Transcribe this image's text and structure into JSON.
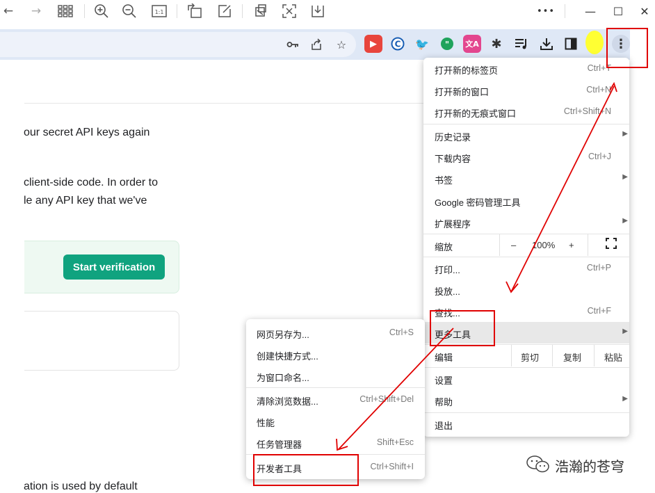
{
  "viewer_toolbar": {
    "icons": [
      "back-arrow-icon",
      "forward-arrow-icon",
      "grid-icon",
      "zoom-in-icon",
      "zoom-out-icon",
      "actual-size-icon",
      "rotate-icon",
      "edit-icon",
      "crop-icon",
      "fit-icon",
      "save-icon"
    ],
    "more": "•••",
    "minimize": "—",
    "maximize": "☐",
    "close": "✕"
  },
  "page": {
    "line1": "our secret API keys again",
    "line2": "client-side code. In order to",
    "line3": "le any API key that we've",
    "verify_button": "Start verification",
    "line4": "ation is used by default"
  },
  "main_menu": {
    "items": [
      {
        "label": "打开新的标签页",
        "shortcut": "Ctrl+T"
      },
      {
        "label": "打开新的窗口",
        "shortcut": "Ctrl+N"
      },
      {
        "label": "打开新的无痕式窗口",
        "shortcut": "Ctrl+Shift+N"
      },
      {
        "label": "历史记录",
        "arrow": "▶"
      },
      {
        "label": "下载内容",
        "shortcut": "Ctrl+J"
      },
      {
        "label": "书签",
        "arrow": "▶"
      },
      {
        "label": "Google 密码管理工具"
      },
      {
        "label": "扩展程序",
        "arrow": "▶"
      }
    ],
    "zoom": {
      "label": "缩放",
      "minus": "–",
      "value": "100%",
      "plus": "+"
    },
    "items2": [
      {
        "label": "打印...",
        "shortcut": "Ctrl+P"
      },
      {
        "label": "投放..."
      },
      {
        "label": "查找...",
        "shortcut": "Ctrl+F"
      },
      {
        "label": "更多工具",
        "arrow": "▶"
      }
    ],
    "edit": {
      "label": "编辑",
      "cut": "剪切",
      "copy": "复制",
      "paste": "粘贴"
    },
    "items3": [
      {
        "label": "设置"
      },
      {
        "label": "帮助",
        "arrow": "▶"
      },
      {
        "label": "退出"
      }
    ]
  },
  "sub_menu": {
    "items": [
      {
        "label": "网页另存为...",
        "shortcut": "Ctrl+S"
      },
      {
        "label": "创建快捷方式..."
      },
      {
        "label": "为窗口命名..."
      },
      {
        "label": "清除浏览数据...",
        "shortcut": "Ctrl+Shift+Del"
      },
      {
        "label": "性能"
      },
      {
        "label": "任务管理器",
        "shortcut": "Shift+Esc"
      },
      {
        "label": "开发者工具",
        "shortcut": "Ctrl+Shift+I"
      }
    ]
  },
  "watermark": "浩瀚的苍穹",
  "colors": {
    "accent_green": "#10a37f",
    "annotation_red": "#e00000",
    "highlight_yellow": "#ffff33"
  }
}
